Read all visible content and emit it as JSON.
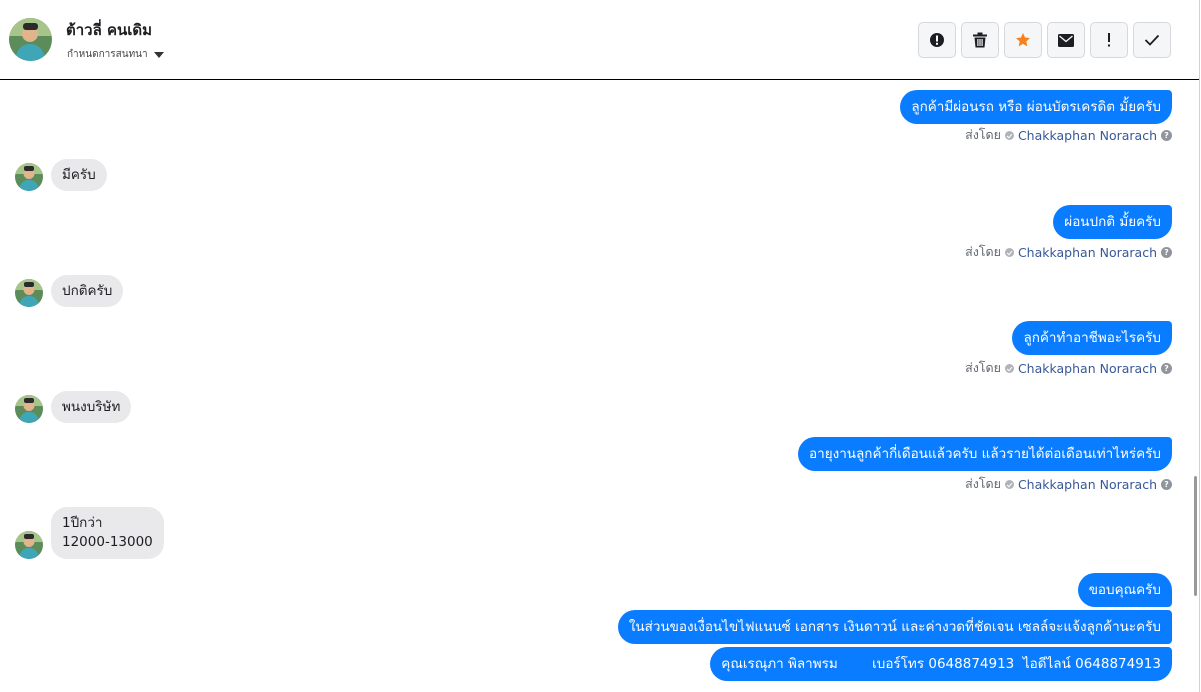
{
  "header": {
    "contact_name": "ต้าวลี่ คนเดิม",
    "assign_label": "กำหนดการสนทนา",
    "actions": [
      {
        "name": "mark-spam-button",
        "icon": "alert-circle-icon"
      },
      {
        "name": "delete-button",
        "icon": "trash-icon"
      },
      {
        "name": "star-button",
        "icon": "star-icon"
      },
      {
        "name": "mark-unread-button",
        "icon": "envelope-icon"
      },
      {
        "name": "follow-up-button",
        "icon": "exclamation-icon"
      },
      {
        "name": "mark-done-button",
        "icon": "check-icon"
      }
    ]
  },
  "messages": [
    {
      "dir": "out",
      "text": "ลูกค้ามีผ่อนรถ หรือ ผ่อนบัตรเครดิต มั้ยครับ"
    },
    {
      "dir": "in",
      "lines": [
        "มีครับ"
      ]
    },
    {
      "dir": "out",
      "text": "ผ่อนปกติ มั้ยครับ"
    },
    {
      "dir": "in",
      "lines": [
        "ปกติครับ"
      ]
    },
    {
      "dir": "out",
      "text": "ลูกค้าทำอาชีพอะไรครับ"
    },
    {
      "dir": "in",
      "lines": [
        "พนงบริษัท"
      ]
    },
    {
      "dir": "out",
      "text": "อายุงานลูกค้ากี่เดือนแล้วครับ แล้วรายได้ต่อเดือนเท่าไหร่ครับ"
    },
    {
      "dir": "in",
      "lines": [
        "1ปีกว่า",
        "12000-13000"
      ]
    },
    {
      "dir": "out",
      "text": "ขอบคุณครับ"
    },
    {
      "dir": "out",
      "text": "ในส่วนของเงื่อนไขไฟแนนซ์ เอกสาร เงินดาวน์ และค่างวดที่ชัดเจน เซลล์จะแจ้งลูกค้านะครับ"
    },
    {
      "dir": "out",
      "text": "คุณเรณุภา พิลาพรม        เบอร์โทร 0648874913  ไอดีไลน์ 0648874913"
    }
  ],
  "sent_by": {
    "prefix": "ส่งโดย",
    "agent": "Chakkaphan Norarach"
  },
  "colors": {
    "outgoing_bubble": "#0a7cff",
    "incoming_bubble": "#e9e9eb",
    "star": "#f5821f",
    "agent_link": "#385898"
  }
}
